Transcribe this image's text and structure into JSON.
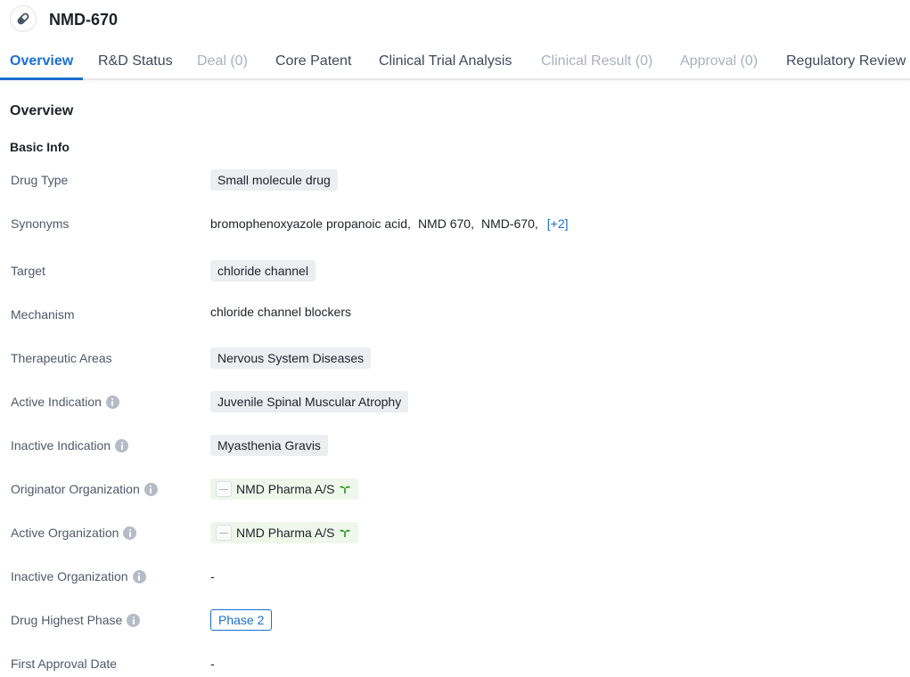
{
  "header": {
    "icon": "pill-icon",
    "title": "NMD-670"
  },
  "tabs": [
    {
      "label": "Overview",
      "state": "active"
    },
    {
      "label": "R&D Status",
      "state": "enabled"
    },
    {
      "label": "Deal (0)",
      "state": "disabled"
    },
    {
      "label": "Core Patent",
      "state": "enabled"
    },
    {
      "label": "Clinical Trial Analysis",
      "state": "enabled"
    },
    {
      "label": "Clinical Result (0)",
      "state": "disabled"
    },
    {
      "label": "Approval (0)",
      "state": "disabled"
    },
    {
      "label": "Regulatory Review",
      "state": "enabled"
    }
  ],
  "overview": {
    "section_title": "Overview",
    "subsection_title": "Basic Info",
    "fields": {
      "drug_type": {
        "label": "Drug Type",
        "value": "Small molecule drug"
      },
      "synonyms": {
        "label": "Synonyms",
        "values": [
          "bromophenoxyazole propanoic acid,",
          "NMD 670,",
          "NMD-670,"
        ],
        "more": "[+2]"
      },
      "target": {
        "label": "Target",
        "value": "chloride channel"
      },
      "mechanism": {
        "label": "Mechanism",
        "value": "chloride channel blockers"
      },
      "therapeutic_areas": {
        "label": "Therapeutic Areas",
        "value": "Nervous System Diseases"
      },
      "active_indication": {
        "label": "Active Indication",
        "value": "Juvenile Spinal Muscular Atrophy"
      },
      "inactive_indication": {
        "label": "Inactive Indication",
        "value": "Myasthenia Gravis"
      },
      "originator_organization": {
        "label": "Originator Organization",
        "value": "NMD Pharma A/S"
      },
      "active_organization": {
        "label": "Active Organization",
        "value": "NMD Pharma A/S"
      },
      "inactive_organization": {
        "label": "Inactive Organization",
        "value": "-"
      },
      "drug_highest_phase": {
        "label": "Drug Highest Phase",
        "value": "Phase 2"
      },
      "first_approval_date": {
        "label": "First Approval Date",
        "value": "-"
      }
    }
  },
  "colors": {
    "accent": "#1a6fcf",
    "tag_bg": "#eceef2",
    "org_tag_bg": "#eef7ea",
    "leaf_green": "#3aa12f",
    "disabled_tab": "#a9b1bd"
  }
}
